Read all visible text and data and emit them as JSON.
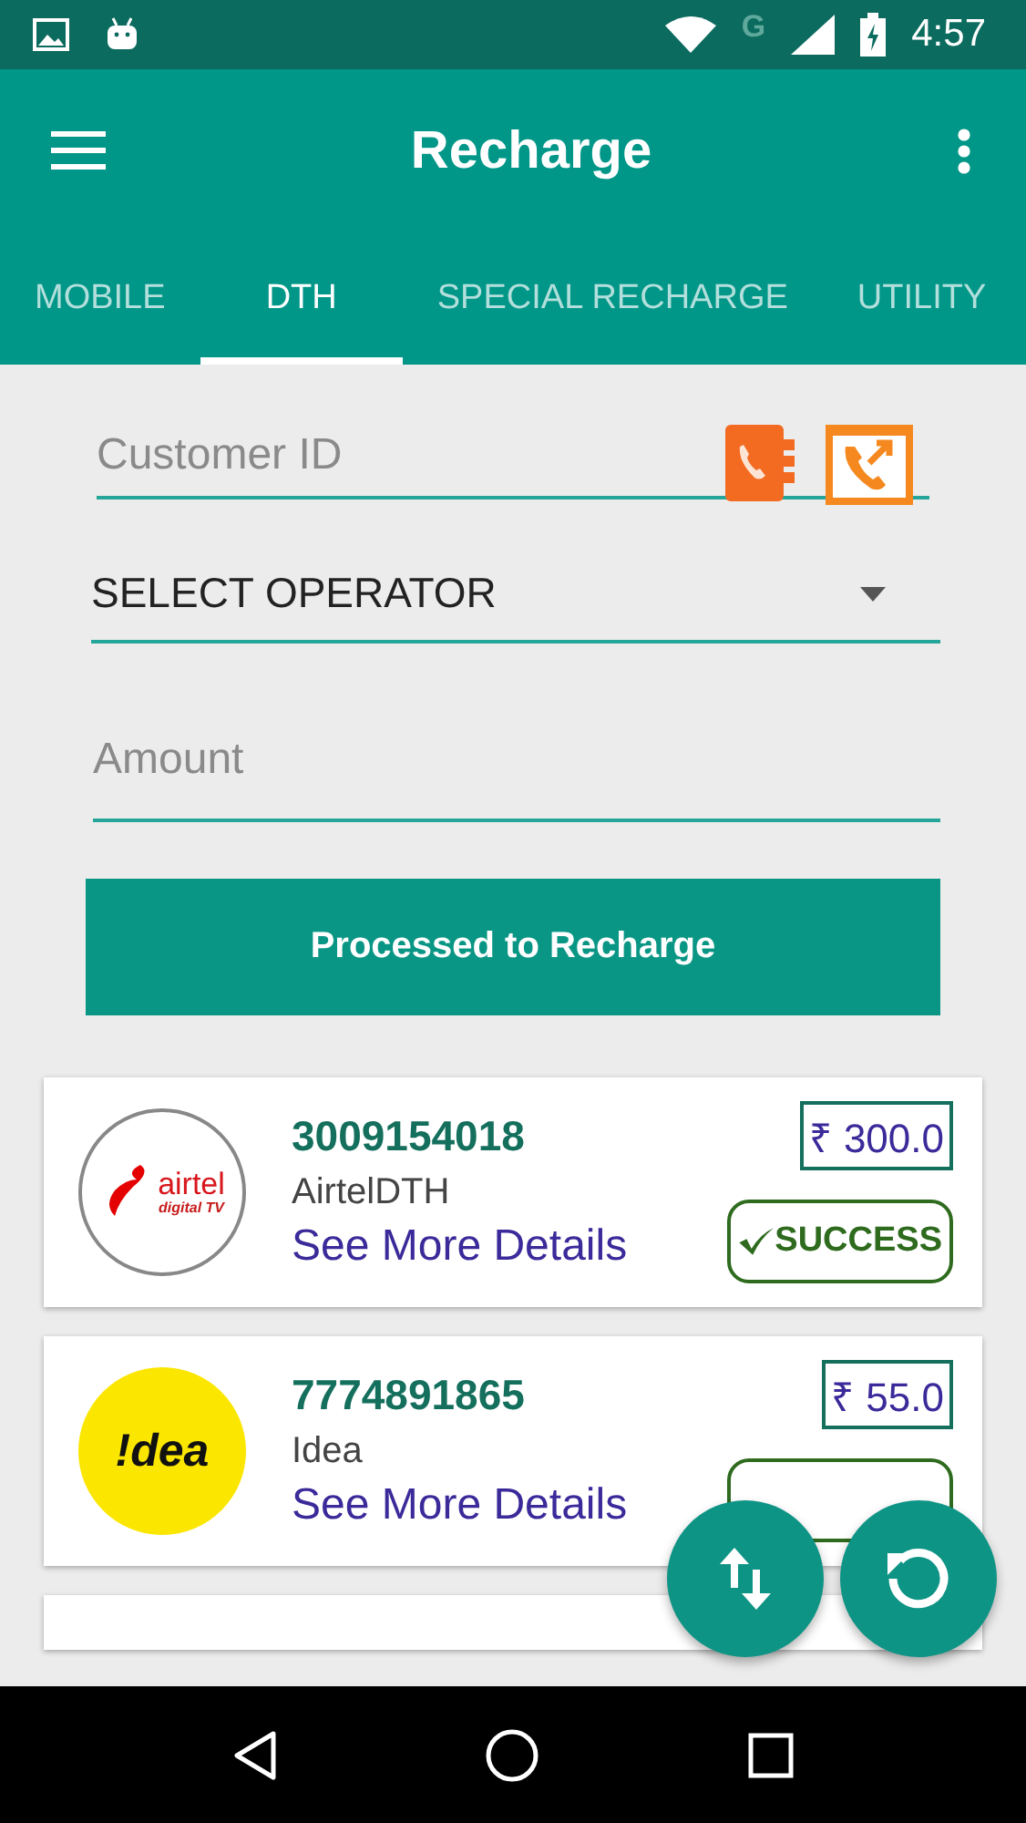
{
  "status_bar": {
    "network_type": "G",
    "time": "4:57"
  },
  "toolbar": {
    "title": "Recharge"
  },
  "tabs": [
    {
      "label": "MOBILE",
      "selected": false
    },
    {
      "label": "DTH",
      "selected": true
    },
    {
      "label": "SPECIAL RECHARGE",
      "selected": false
    },
    {
      "label": "UTILITY",
      "selected": false
    }
  ],
  "form": {
    "customer_id": {
      "placeholder": "Customer ID"
    },
    "operator": {
      "value": "SELECT OPERATOR"
    },
    "amount": {
      "placeholder": "Amount"
    },
    "submit": "Processed to Recharge"
  },
  "history": [
    {
      "number": "3009154018",
      "operator": "AirtelDTH",
      "link": "See More Details",
      "amount": "₹ 300.0",
      "logo": {
        "kind": "airtel",
        "text": "airtel",
        "subtext": "digital TV"
      },
      "status": {
        "kind": "success",
        "label": "SUCCESS"
      }
    },
    {
      "number": "7774891865",
      "operator": "Idea",
      "link": "See More Details",
      "amount": "₹ 55.0",
      "logo": {
        "kind": "idea",
        "text": "!dea"
      },
      "status": {
        "kind": "success"
      }
    }
  ]
}
